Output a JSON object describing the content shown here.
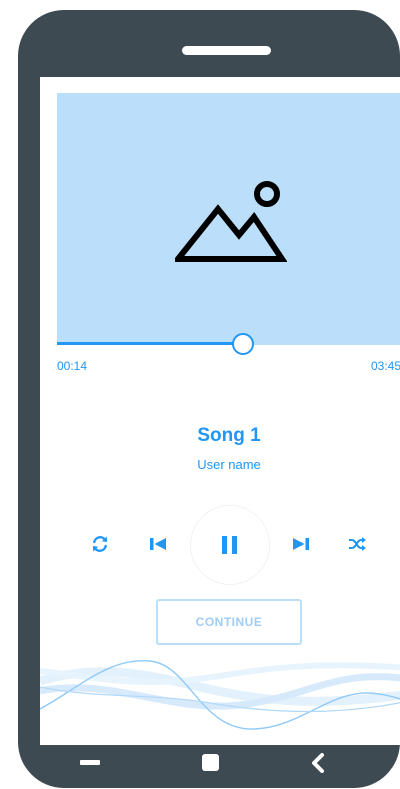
{
  "player": {
    "progress": {
      "current_time": "00:14",
      "total_time": "03:45",
      "fraction": 0.54
    },
    "song_title": "Song 1",
    "artist": "User name",
    "controls": {
      "repeat_icon": "repeat-icon",
      "previous_icon": "skip-previous-icon",
      "play_pause_icon": "pause-icon",
      "next_icon": "skip-next-icon",
      "shuffle_icon": "shuffle-icon"
    },
    "continue_label": "CONTINUE",
    "artwork_icon": "image-placeholder-icon"
  },
  "navbar": {
    "back_icon": "back-chevron-icon",
    "home_icon": "home-square-icon",
    "recents_icon": "recents-bar-icon"
  },
  "colors": {
    "accent": "#2196f3",
    "artwork_bg": "#bbdefb",
    "phone_frame": "#3d4a52"
  }
}
